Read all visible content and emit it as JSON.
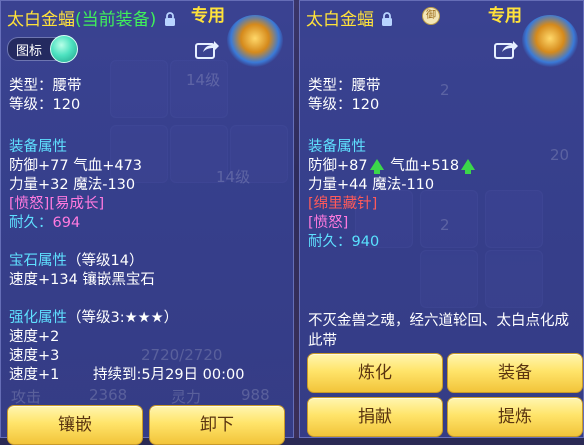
{
  "left": {
    "item_name": "太白金蝠",
    "equipped_tag": "(当前装备)",
    "exclusive": "专用",
    "toggle_label": "图标",
    "type_line": "类型：腰带",
    "level_line": "等级：120",
    "equip_attr_header": "装备属性",
    "stats_line1": "防御+77 气血+473",
    "stats_line2": "力量+32 魔法-130",
    "special": "[愤怒][易成长]",
    "durability_label": "耐久：",
    "durability_value": "694",
    "gem_header": "宝石属性",
    "gem_level": "（等级14）",
    "gem_line": "速度+134 镶嵌黑宝石",
    "enhance_header": "强化属性",
    "enhance_level": "（等级3:★★★）",
    "enhance_lines": [
      "速度+2",
      "速度+3",
      "速度+1"
    ],
    "duration": "持续到:5月29日 00:00",
    "buttons": [
      "镶嵌",
      "卸下"
    ]
  },
  "right": {
    "item_name": "太白金蝠",
    "ring_badge": "御",
    "exclusive": "专用",
    "type_line": "类型：腰带",
    "level_line": "等级：120",
    "equip_attr_header": "装备属性",
    "stat_def": "防御+87",
    "stat_hp": "气血+518",
    "stats_line2": "力量+44 魔法-110",
    "special1": "[绵里藏针]",
    "special2": "[愤怒]",
    "durability_label": "耐久：",
    "durability_value": "940",
    "description": "不灭金兽之魂，经六道轮回、太白点化成此带",
    "buttons": [
      "炼化",
      "装备",
      "捐献",
      "提炼"
    ]
  },
  "background": {
    "numbers": [
      "14级",
      "14级",
      "2720/2720",
      "2368",
      "988",
      "20",
      "2",
      "2"
    ],
    "words": [
      "攻击",
      "灵力"
    ]
  },
  "colors": {
    "title": "#ffe23a",
    "equipped": "#3ff05a",
    "section": "#5fe0ff",
    "special": "#ff7adf",
    "special_red": "#ff5a5a",
    "arrow_up": "#3bd84a",
    "button": "#ffe46a"
  },
  "icons": [
    "lock-icon",
    "belt-item-icon",
    "share-icon",
    "up-arrow-icon",
    "ring-badge-icon"
  ]
}
